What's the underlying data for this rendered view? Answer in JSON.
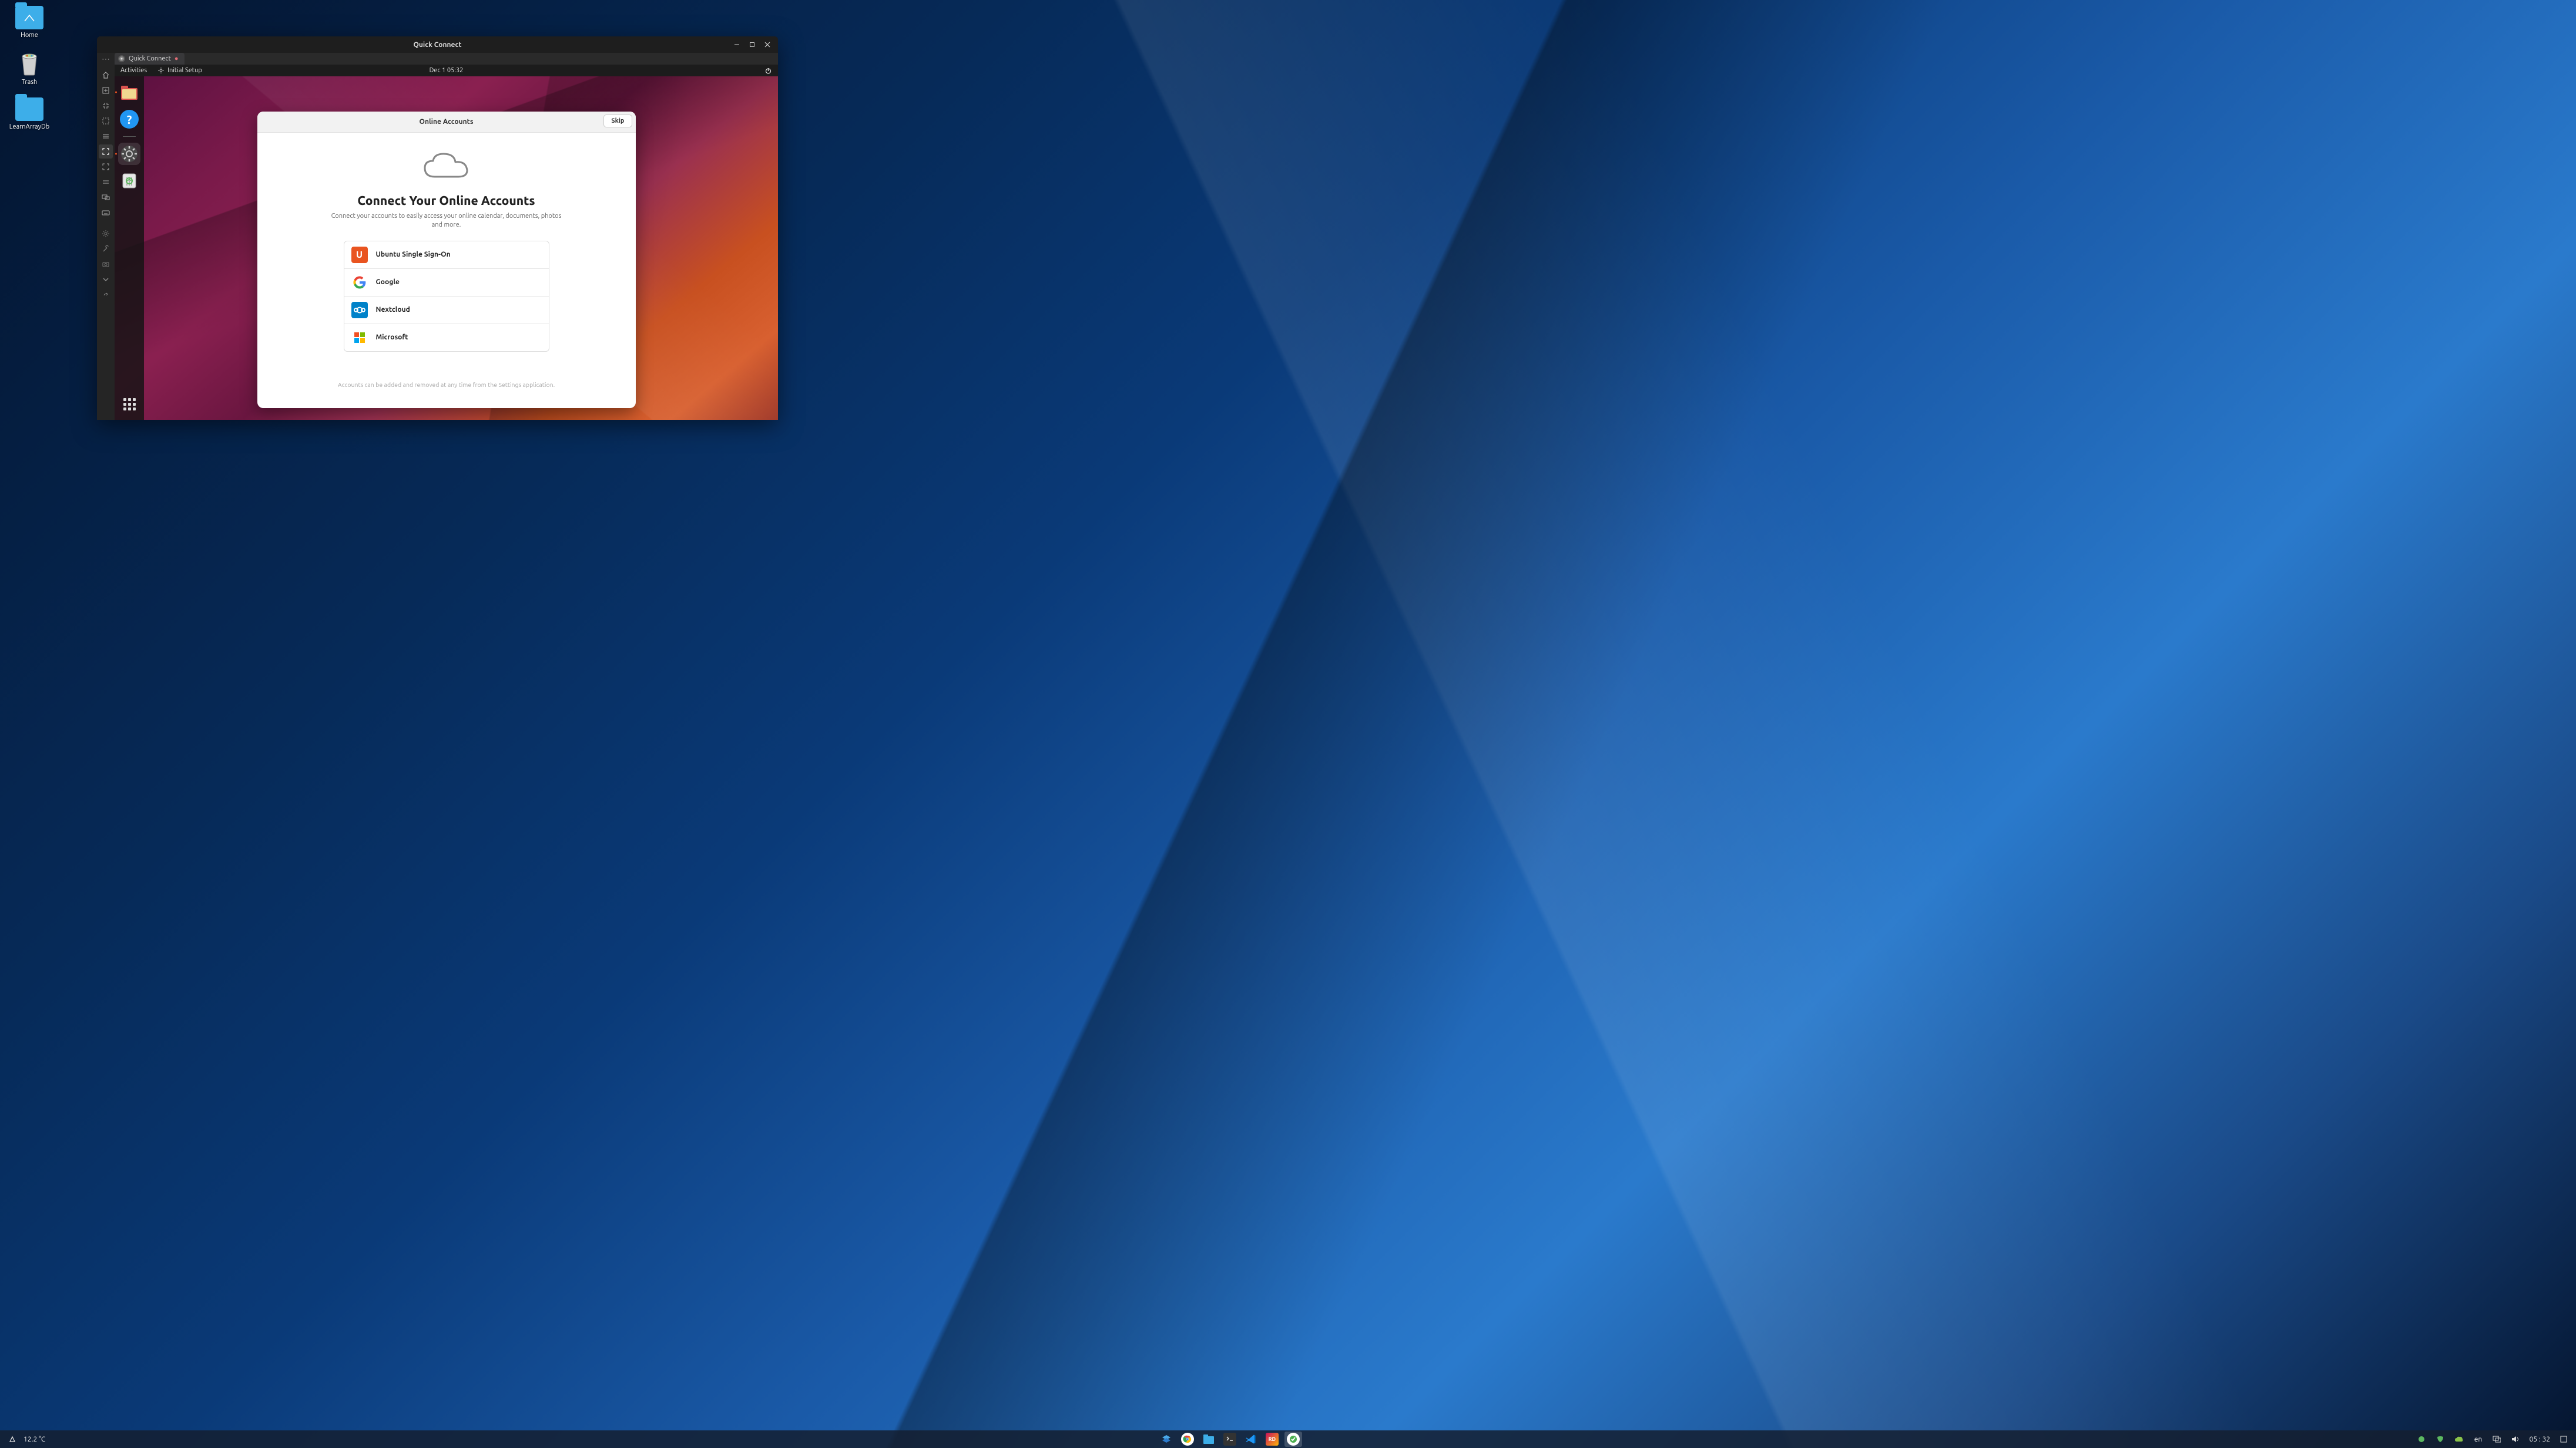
{
  "host": {
    "desktop_icons": [
      {
        "label": "Home",
        "type": "folder"
      },
      {
        "label": "Trash",
        "type": "trash"
      },
      {
        "label": "LearnArrayDb",
        "type": "folder"
      }
    ],
    "taskbar": {
      "weather": "12.2 °C",
      "tray": {
        "lang": "en",
        "clock": "05 : 32"
      }
    }
  },
  "window": {
    "title": "Quick Connect",
    "tab": {
      "label": "Quick Connect"
    }
  },
  "guest": {
    "topbar": {
      "activities": "Activities",
      "app": "Initial Setup",
      "clock": "Dec 1  05:32"
    },
    "dialog": {
      "header": "Online Accounts",
      "skip": "Skip",
      "title": "Connect Your Online Accounts",
      "subtitle": "Connect your accounts to easily access your online calendar, documents, photos and more.",
      "accounts": [
        {
          "label": "Ubuntu Single Sign-On"
        },
        {
          "label": "Google"
        },
        {
          "label": "Nextcloud"
        },
        {
          "label": "Microsoft"
        }
      ],
      "footer": "Accounts can be added and removed at any time from the Settings application."
    }
  }
}
